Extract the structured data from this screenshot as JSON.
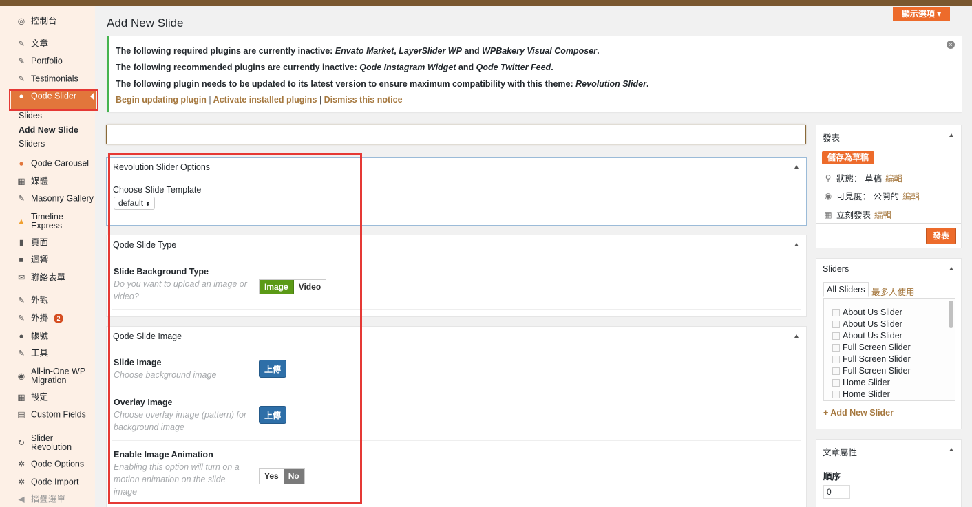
{
  "sidebar": {
    "items": [
      {
        "icon": "dashboard-icon",
        "glyph": "◎",
        "label": "控制台"
      },
      {
        "icon": "pin-icon",
        "glyph": "✎",
        "label": "文章"
      },
      {
        "icon": "pin-icon",
        "glyph": "✎",
        "label": "Portfolio"
      },
      {
        "icon": "pin-icon",
        "glyph": "✎",
        "label": "Testimonials"
      },
      {
        "icon": "qode-slider-icon",
        "glyph": "●",
        "label": "Qode Slider"
      },
      {
        "icon": "carousel-icon",
        "glyph": "●",
        "label": "Qode Carousel"
      },
      {
        "icon": "media-icon",
        "glyph": "▦",
        "label": "媒體"
      },
      {
        "icon": "pin-icon",
        "glyph": "✎",
        "label": "Masonry Gallery"
      },
      {
        "icon": "timeline-icon",
        "glyph": "▲",
        "label": "Timeline Express"
      },
      {
        "icon": "pages-icon",
        "glyph": "▮",
        "label": "頁面"
      },
      {
        "icon": "comments-icon",
        "glyph": "■",
        "label": "迴響"
      },
      {
        "icon": "mail-icon",
        "glyph": "✉",
        "label": "聯絡表單"
      },
      {
        "icon": "appearance-icon",
        "glyph": "✎",
        "label": "外觀"
      },
      {
        "icon": "plugins-icon",
        "glyph": "✎",
        "label": "外掛",
        "badge": "2"
      },
      {
        "icon": "users-icon",
        "glyph": "●",
        "label": "帳號"
      },
      {
        "icon": "tools-icon",
        "glyph": "✎",
        "label": "工具"
      },
      {
        "icon": "migration-icon",
        "glyph": "◉",
        "label": "All-in-One WP Migration"
      },
      {
        "icon": "settings-icon",
        "glyph": "▦",
        "label": "設定"
      },
      {
        "icon": "custom-fields-icon",
        "glyph": "▤",
        "label": "Custom Fields"
      },
      {
        "icon": "revolution-icon",
        "glyph": "↻",
        "label": "Slider Revolution"
      },
      {
        "icon": "gear-icon",
        "glyph": "✲",
        "label": "Qode Options"
      },
      {
        "icon": "import-icon",
        "glyph": "✲",
        "label": "Qode Import"
      },
      {
        "icon": "collapse-icon",
        "glyph": "◀",
        "label": "摺疊選單"
      }
    ],
    "submenu": [
      "Slides",
      "Add New Slide",
      "Sliders"
    ]
  },
  "screen_options": "顯示選項 ▾",
  "page_title": "Add New Slide",
  "notice": {
    "line1_a": "The following required plugins are currently inactive: ",
    "line1_p1": "Envato Market",
    "line1_b": ", ",
    "line1_p2": "LayerSlider WP",
    "line1_c": " and ",
    "line1_p3": "WPBakery Visual Composer",
    "line1_d": ".",
    "line2_a": "The following recommended plugins are currently inactive: ",
    "line2_p1": "Qode Instagram Widget",
    "line2_b": " and ",
    "line2_p2": "Qode Twitter Feed",
    "line2_c": ".",
    "line3_a": "The following plugin needs to be updated to its latest version to ensure maximum compatibility with this theme: ",
    "line3_p1": "Revolution Slider",
    "line3_b": ".",
    "link1": "Begin updating plugin",
    "link2": "Activate installed plugins",
    "link3": "Dismiss this notice",
    "sep": "|"
  },
  "rev_box": {
    "title": "Revolution Slider Options",
    "label": "Choose Slide Template",
    "select_value": "default"
  },
  "type_box": {
    "title": "Qode Slide Type",
    "field_label": "Slide Background Type",
    "field_desc": "Do you want to upload an image or video?",
    "opt_image": "Image",
    "opt_video": "Video"
  },
  "image_box": {
    "title": "Qode Slide Image",
    "slide_image_label": "Slide Image",
    "slide_image_desc": "Choose background image",
    "overlay_label": "Overlay Image",
    "overlay_desc": "Choose overlay image (pattern) for background image",
    "anim_label": "Enable Image Animation",
    "anim_desc": "Enabling this option will turn on a motion animation on the slide image",
    "upload": "上傳",
    "yes": "Yes",
    "no": "No"
  },
  "publish": {
    "title": "發表",
    "save_draft": "儲存為草稿",
    "status_label": "狀態：",
    "status_value": "草稿",
    "visibility_label": "可見度：",
    "visibility_value": "公開的",
    "schedule_label": "立刻發表",
    "edit": "編輯",
    "publish_btn": "發表"
  },
  "sliders_box": {
    "title": "Sliders",
    "tab_all": "All Sliders",
    "tab_popular": "最多人使用",
    "items": [
      "About Us Slider",
      "About Us Slider",
      "About Us Slider",
      "Full Screen Slider",
      "Full Screen Slider",
      "Full Screen Slider",
      "Home Slider",
      "Home Slider"
    ],
    "add_new": "+ Add New Slider"
  },
  "attributes": {
    "title": "文章屬性",
    "order_label": "順序",
    "order_value": "0"
  },
  "colors": {
    "accent": "#ed6b2b",
    "notice_border": "#46b450",
    "link": "#a67940",
    "highlight_outline": "#e53935"
  }
}
